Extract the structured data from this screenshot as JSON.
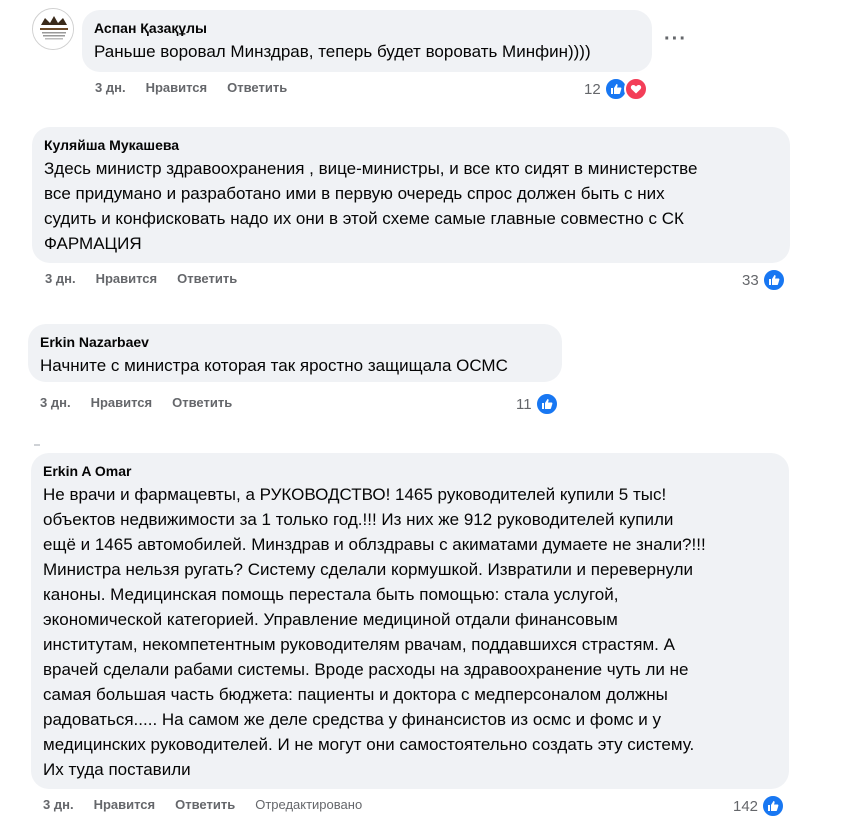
{
  "colors": {
    "like": "#1877f2",
    "love": "#f33e58",
    "bubble": "#f0f2f5",
    "meta": "#65676b"
  },
  "comments": [
    {
      "author": "Аспан Қазақұлы",
      "text": "Раньше воровал Минздрав, теперь будет воровать Минфин))))",
      "time": "3 дн.",
      "like_label": "Нравится",
      "reply_label": "Ответить",
      "reactions": "12",
      "reaction_icons": [
        "like-icon",
        "love-icon"
      ]
    },
    {
      "author": "Куляйша Мукашева",
      "text_lines": [
        "Здесь министр здравоохранения , вице-министры, и все кто сидят в министерстве",
        "все придумано и разработано ими в первую очередь спрос должен быть с них",
        "судить и конфисковать надо их они в этой схеме самые главные совместно с СК",
        "ФАРМАЦИЯ"
      ],
      "time": "3 дн.",
      "like_label": "Нравится",
      "reply_label": "Ответить",
      "reactions": "33",
      "reaction_icons": [
        "like-icon"
      ]
    },
    {
      "author": "Erkin Nazarbaev",
      "text": "Начните с министра которая так яростно защищала ОСМС",
      "time": "3 дн.",
      "like_label": "Нравится",
      "reply_label": "Ответить",
      "reactions": "11",
      "reaction_icons": [
        "like-icon"
      ]
    },
    {
      "author": "Erkin A Omar",
      "text_lines": [
        "Не врачи и фармацевты, а РУКОВОДСТВО! 1465 руководителей купили 5 тыс!",
        "объектов недвижимости за 1 только год.!!! Из них же 912 руководителей купили",
        "ещё и 1465 автомобилей. Минздрав и облздравы с акиматами думаете не знали?!!!",
        "Министра нельзя ругать? Систему сделали кормушкой. Извратили и перевернули",
        "каноны. Медицинская помощь перестала быть помощью: стала услугой,",
        "экономической категорией. Управление медициной отдали финансовым",
        "институтам, некомпетентным руководителям рвачам, поддавшихся страстям. А",
        "врачей сделали рабами системы. Вроде расходы на здравоохранение чуть ли не",
        "самая большая часть бюджета: пациенты и доктора с медперсоналом должны",
        "радоваться..... На самом же деле средства у финансистов из осмс и фомс и у",
        "медицинских руководителей. И не могут они самостоятельно создать эту систему.",
        "Их туда поставили"
      ],
      "time": "3 дн.",
      "like_label": "Нравится",
      "reply_label": "Ответить",
      "edited_label": "Отредактировано",
      "reactions": "142",
      "reaction_icons": [
        "like-icon"
      ]
    }
  ],
  "more_options_label": "···"
}
